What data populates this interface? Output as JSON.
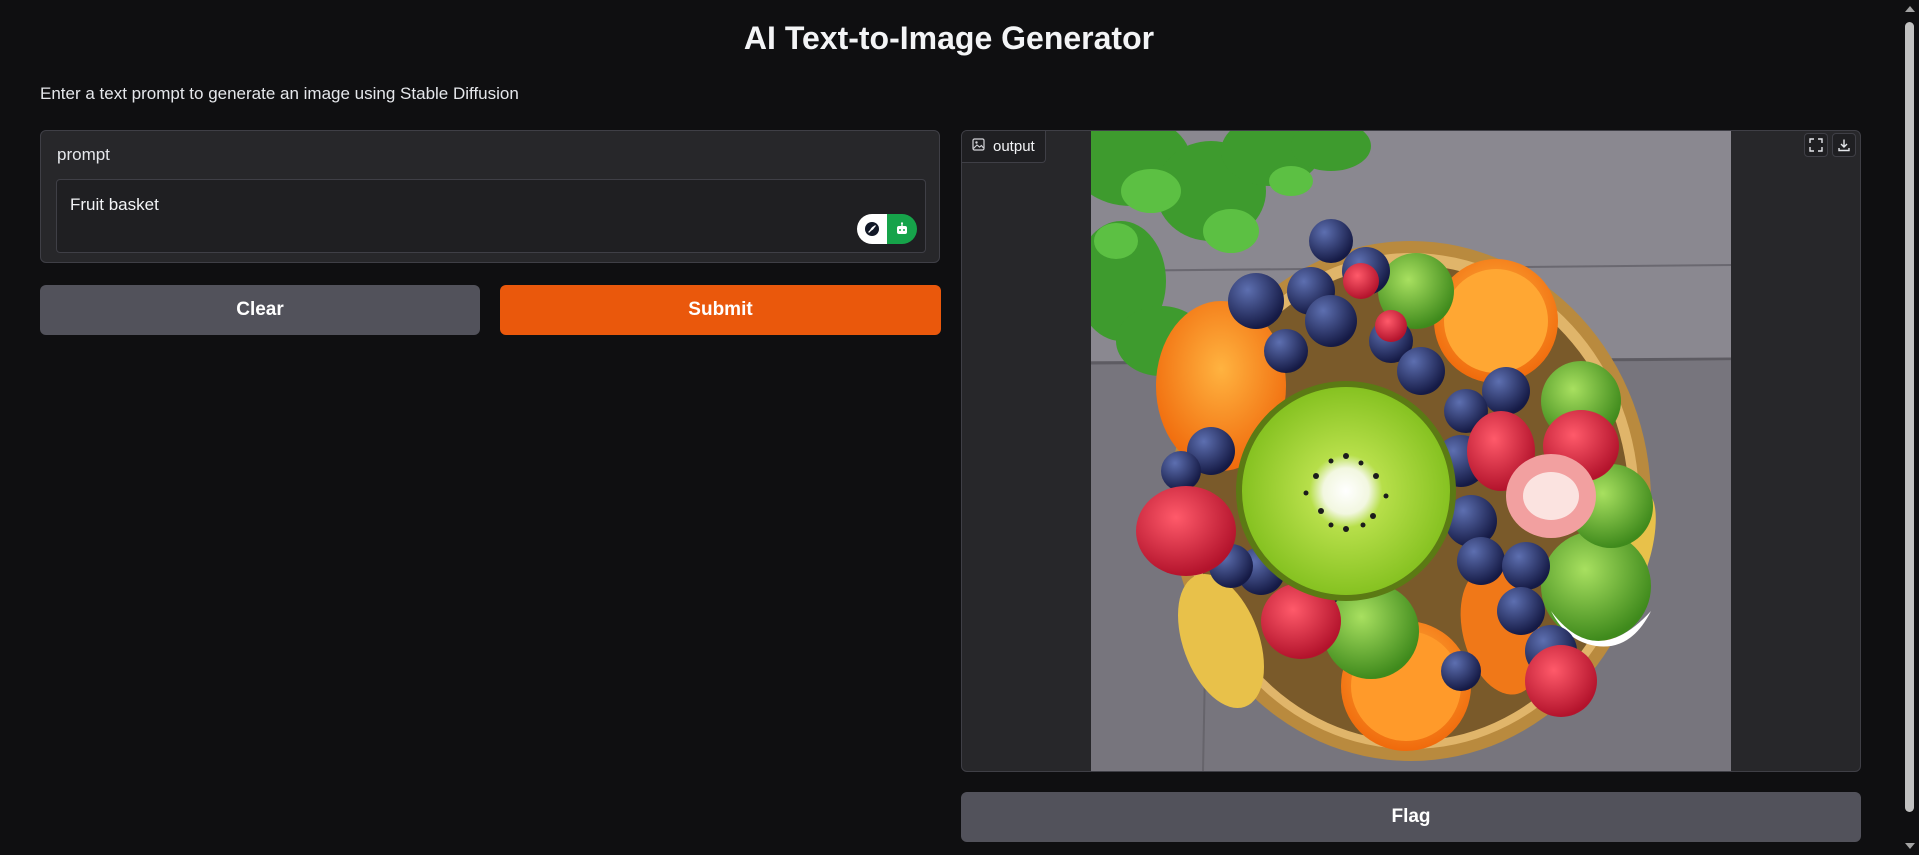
{
  "header": {
    "title": "AI Text-to-Image Generator",
    "description": "Enter a text prompt to generate an image using Stable Diffusion"
  },
  "input": {
    "label": "prompt",
    "value": "Fruit basket"
  },
  "buttons": {
    "clear": "Clear",
    "submit": "Submit",
    "flag": "Flag"
  },
  "output": {
    "label": "output",
    "image_subject": "fruit basket with kiwi, berries, oranges and limes on stone pavement"
  },
  "icons": {
    "output_label_icon": "image-icon",
    "fullscreen": "fullscreen-icon",
    "download": "download-icon",
    "ext_left": "feather-icon",
    "ext_right": "robot-icon"
  },
  "colors": {
    "background": "#0f0f11",
    "panel": "#27272a",
    "submit": "#ea580c",
    "secondary_button": "#52525b",
    "extension_green": "#16a34a"
  }
}
